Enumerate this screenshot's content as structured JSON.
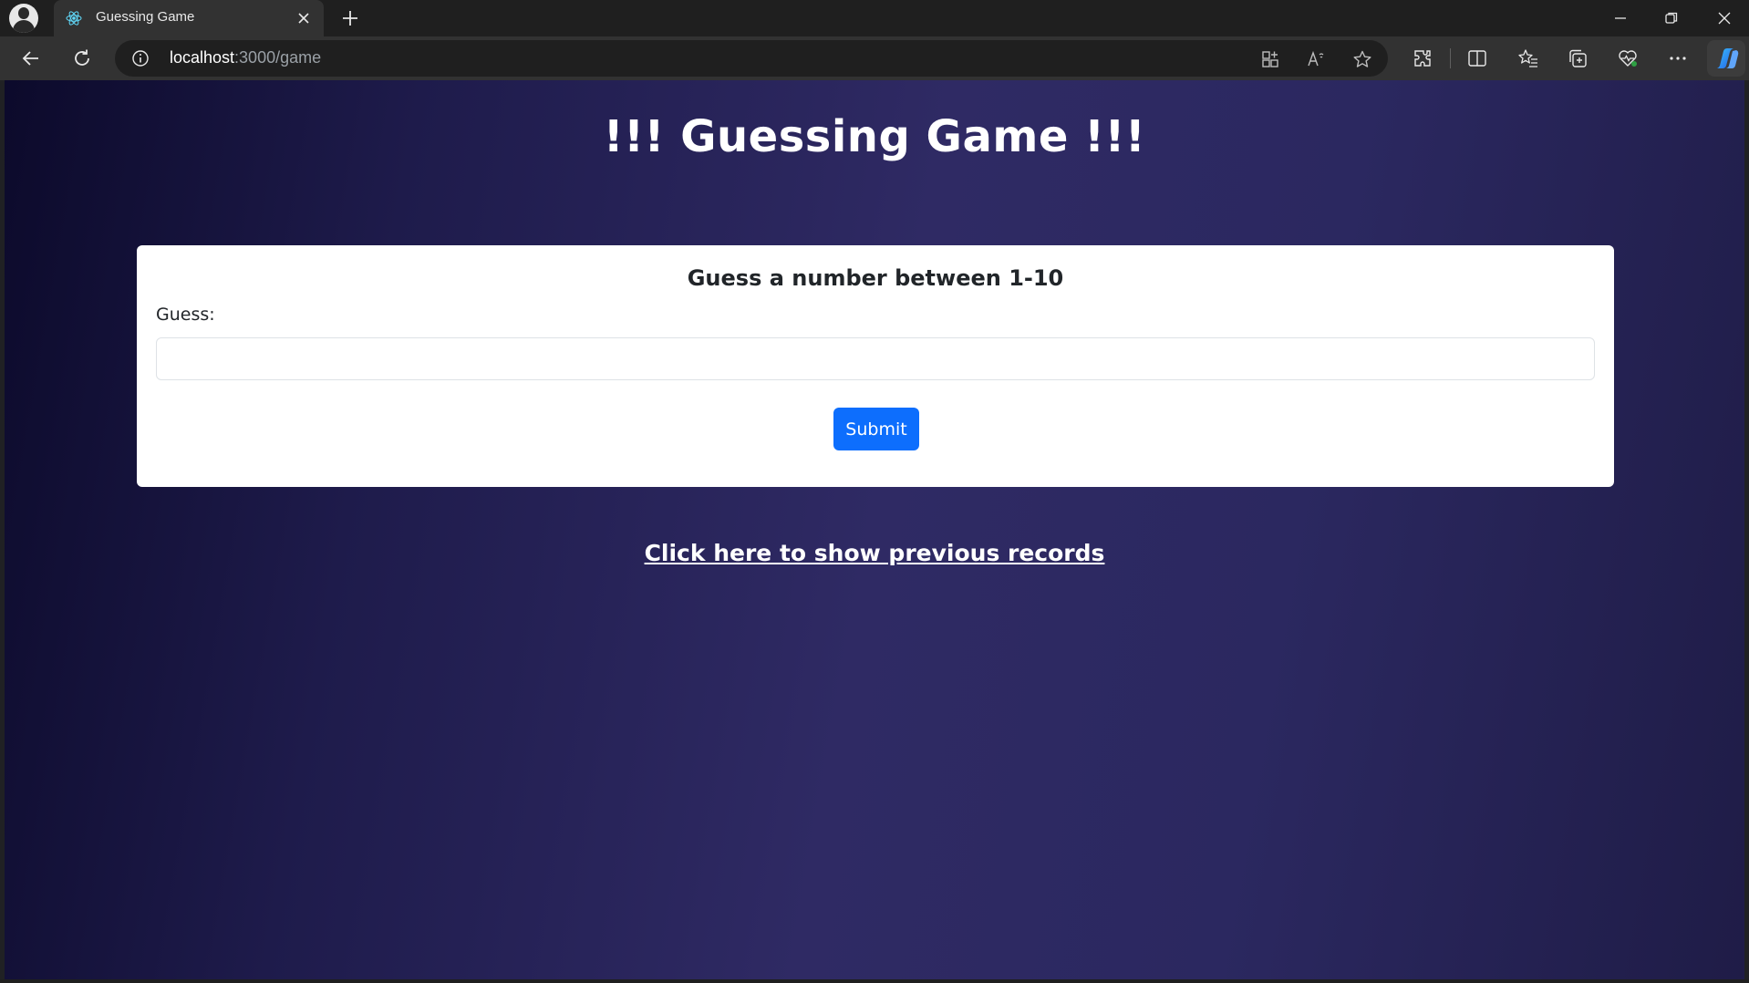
{
  "browser": {
    "tab": {
      "title": "Guessing Game"
    },
    "address": {
      "host": "localhost",
      "path": ":3000/game"
    }
  },
  "page": {
    "title": "!!! Guessing Game !!!",
    "card": {
      "heading": "Guess a number between 1-10",
      "guess_label": "Guess:",
      "guess_value": "",
      "submit_label": "Submit"
    },
    "records_link": "Click here to show previous records"
  },
  "colors": {
    "primary_button": "#0d6efd",
    "page_gradient_dark": "#0c0a2b",
    "page_gradient_light": "#2f2a64"
  }
}
